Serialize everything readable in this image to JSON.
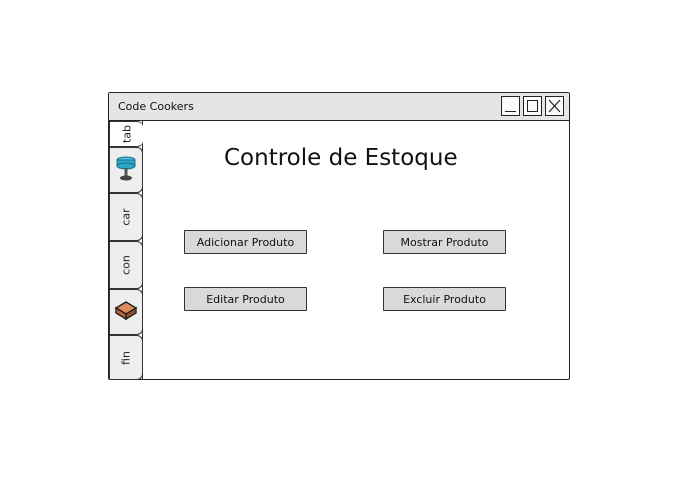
{
  "window": {
    "title": "Code Cookers"
  },
  "tabs": [
    {
      "label": "tab"
    },
    {
      "icon": "pedestal-table-icon"
    },
    {
      "label": "car"
    },
    {
      "label": "con"
    },
    {
      "icon": "brick-icon"
    },
    {
      "label": "fin"
    }
  ],
  "main": {
    "heading": "Controle de Estoque",
    "buttons": {
      "add": "Adicionar Produto",
      "show": "Mostrar Produto",
      "edit": "Editar Produto",
      "delete": "Excluir Produto"
    }
  },
  "colors": {
    "titlebar": "#e5e5e5",
    "button": "#d9d9d9",
    "tab": "#eeeeee",
    "icon_teal": "#2aa7c9",
    "icon_brick": "#c9764a"
  }
}
